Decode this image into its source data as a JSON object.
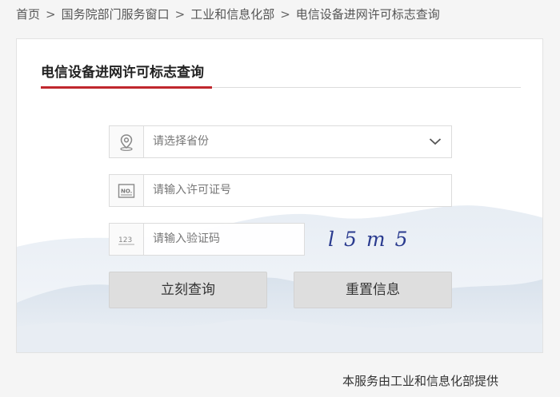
{
  "breadcrumb": {
    "items": [
      "首页",
      "国务院部门服务窗口",
      "工业和信息化部",
      "电信设备进网许可标志查询"
    ],
    "separator": ">"
  },
  "card": {
    "title": "电信设备进网许可标志查询",
    "province_select": {
      "placeholder": "请选择省份",
      "icon": "location-pin-icon"
    },
    "license_input": {
      "placeholder": "请输入许可证号",
      "icon": "license-no-icon"
    },
    "captcha_input": {
      "placeholder": "请输入验证码",
      "icon": "numeric-123-icon"
    },
    "captcha_text": "l5m5",
    "query_button": "立刻查询",
    "reset_button": "重置信息"
  },
  "footer": {
    "text": "本服务由工业和信息化部提供"
  },
  "colors": {
    "accent": "#c0272d",
    "button_bg": "#dedede",
    "page_bg": "#f5f5f5"
  }
}
